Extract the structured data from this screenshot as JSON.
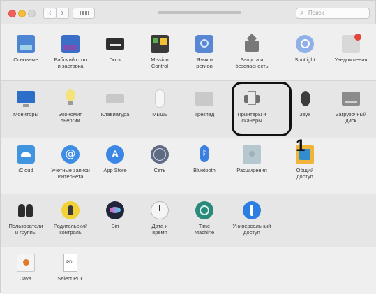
{
  "search": {
    "placeholder": "Поиск"
  },
  "callout": {
    "number": "1"
  },
  "rows": [
    [
      {
        "id": "general",
        "label": "Основные",
        "icon": "general-icon"
      },
      {
        "id": "desktop",
        "label": "Рабочий стол\nи заставка",
        "icon": "desktop-screensaver-icon"
      },
      {
        "id": "dock",
        "label": "Dock",
        "icon": "dock-icon"
      },
      {
        "id": "mission",
        "label": "Mission\nControl",
        "icon": "mission-control-icon"
      },
      {
        "id": "lang",
        "label": "Язык и\nрегион",
        "icon": "language-region-icon"
      },
      {
        "id": "security",
        "label": "Защита и\nбезопасность",
        "icon": "security-icon"
      },
      {
        "id": "spotlight",
        "label": "Spotlight",
        "icon": "spotlight-icon"
      },
      {
        "id": "notif",
        "label": "Уведомления",
        "icon": "notifications-icon"
      }
    ],
    [
      {
        "id": "monitor",
        "label": "Мониторы",
        "icon": "displays-icon"
      },
      {
        "id": "energy",
        "label": "Экономия\nэнергии",
        "icon": "energy-saver-icon"
      },
      {
        "id": "keyboard",
        "label": "Клавиатура",
        "icon": "keyboard-icon"
      },
      {
        "id": "mouse",
        "label": "Мышь",
        "icon": "mouse-icon"
      },
      {
        "id": "trackpad",
        "label": "Трекпад",
        "icon": "trackpad-icon"
      },
      {
        "id": "printer",
        "label": "Принтеры и\nсканеры",
        "icon": "printer-icon"
      },
      {
        "id": "sound",
        "label": "Звук",
        "icon": "sound-icon"
      },
      {
        "id": "startup",
        "label": "Загрузочный\nдиск",
        "icon": "startup-disk-icon"
      }
    ],
    [
      {
        "id": "icloud",
        "label": "iCloud",
        "icon": "icloud-icon"
      },
      {
        "id": "inet",
        "label": "Учетные записи\nИнтернета",
        "icon": "internet-accounts-icon"
      },
      {
        "id": "appstore",
        "label": "App Store",
        "icon": "app-store-icon"
      },
      {
        "id": "network",
        "label": "Сеть",
        "icon": "network-icon"
      },
      {
        "id": "bt",
        "label": "Bluetooth",
        "icon": "bluetooth-icon"
      },
      {
        "id": "ext",
        "label": "Расширения",
        "icon": "extensions-icon"
      },
      {
        "id": "sharing",
        "label": "Общий\nдоступ",
        "icon": "sharing-icon"
      }
    ],
    [
      {
        "id": "users",
        "label": "Пользователи\nи группы",
        "icon": "users-groups-icon"
      },
      {
        "id": "parental",
        "label": "Родительский\nконтроль",
        "icon": "parental-controls-icon"
      },
      {
        "id": "siri",
        "label": "Siri",
        "icon": "siri-icon"
      },
      {
        "id": "datetime",
        "label": "Дата и\nвремя",
        "icon": "date-time-icon"
      },
      {
        "id": "timemachine",
        "label": "Time\nMachine",
        "icon": "time-machine-icon"
      },
      {
        "id": "access",
        "label": "Универсальный\nдоступ",
        "icon": "accessibility-icon"
      }
    ],
    [
      {
        "id": "java",
        "label": "Java",
        "icon": "java-icon"
      },
      {
        "id": "pdl",
        "label": "Select PDL",
        "icon": "select-pdl-icon",
        "icon_text": "PDL"
      }
    ]
  ]
}
